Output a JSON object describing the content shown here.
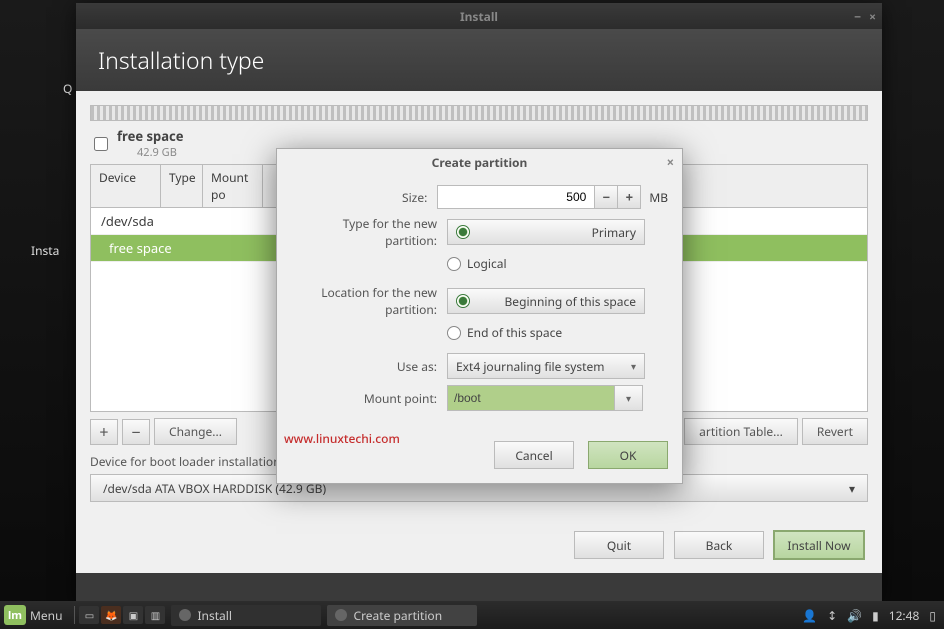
{
  "window": {
    "title": "Install",
    "heading": "Installation type"
  },
  "behind": {
    "cut1": "Q",
    "cut2": "Insta"
  },
  "freespace": {
    "label": "free space",
    "size": "42.9 GB"
  },
  "part_table": {
    "columns": [
      "Device",
      "Type",
      "Mount po"
    ],
    "rows": [
      {
        "text": "/dev/sda",
        "kind": "disk"
      },
      {
        "text": "free space",
        "kind": "free"
      }
    ]
  },
  "toolbar": {
    "plus": "+",
    "minus": "−",
    "change": "Change...",
    "new_table": "artition Table...",
    "revert": "Revert"
  },
  "bootloader": {
    "label": "Device for boot loader installation:",
    "value": "/dev/sda ATA VBOX HARDDISK (42.9 GB)"
  },
  "footer": {
    "quit": "Quit",
    "back": "Back",
    "install": "Install Now"
  },
  "modal": {
    "title": "Create partition",
    "size_label": "Size:",
    "size_value": "500",
    "size_unit": "MB",
    "type_label": "Type for the new partition:",
    "type_primary": "Primary",
    "type_logical": "Logical",
    "loc_label": "Location for the new partition:",
    "loc_begin": "Beginning of this space",
    "loc_end": "End of this space",
    "use_as_label": "Use as:",
    "use_as_value": "Ext4 journaling file system",
    "mount_label": "Mount point:",
    "mount_value": "/boot",
    "cancel": "Cancel",
    "ok": "OK"
  },
  "watermark": "www.linuxtechi.com",
  "panel": {
    "menu": "Menu",
    "task1": "Install",
    "task2": "Create partition",
    "clock": "12:48"
  }
}
